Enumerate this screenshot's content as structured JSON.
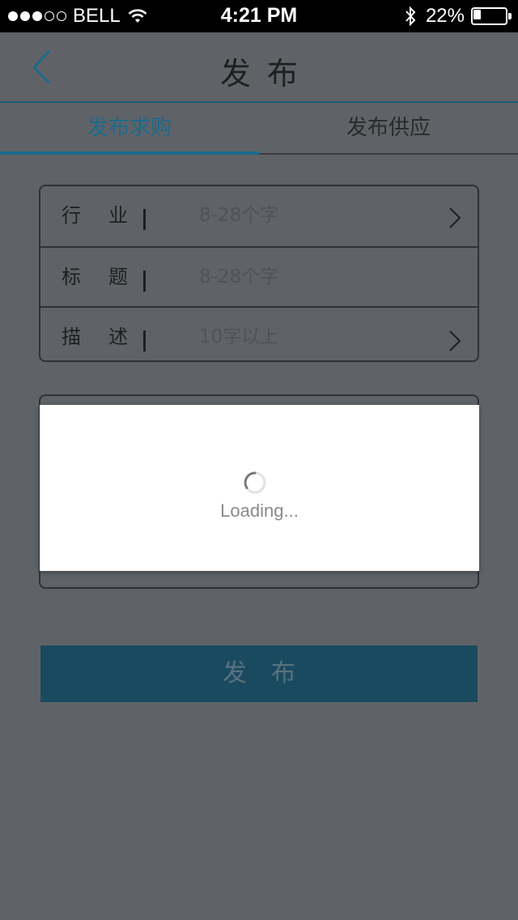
{
  "status_bar": {
    "signal_dots": [
      "filled",
      "filled",
      "filled",
      "empty",
      "empty"
    ],
    "carrier": "BELL",
    "wifi_icon": "wifi-icon",
    "time": "4:21 PM",
    "bluetooth_icon": "bluetooth-icon",
    "battery_percent": "22%",
    "battery_level": 0.22
  },
  "nav": {
    "back_icon": "chevron-left-icon",
    "title": "发布"
  },
  "tabs": [
    {
      "label": "发布求购",
      "active": true
    },
    {
      "label": "发布供应",
      "active": false
    }
  ],
  "form": {
    "rows": [
      {
        "label_1": "行",
        "label_2": "业",
        "separator": "|",
        "placeholder": "8-28个字",
        "has_chevron": true
      },
      {
        "label_1": "标",
        "label_2": "题",
        "separator": "|",
        "placeholder": "8-28个字",
        "has_chevron": false
      },
      {
        "label_1": "描",
        "label_2": "述",
        "separator": "|",
        "placeholder": "10字以上",
        "has_chevron": true
      }
    ]
  },
  "publish_button": {
    "label": "发布"
  },
  "loading": {
    "text": "Loading..."
  },
  "colors": {
    "accent": "#1c6a8c",
    "overlay_background": "#5f6367",
    "button": "#1a4a60"
  }
}
